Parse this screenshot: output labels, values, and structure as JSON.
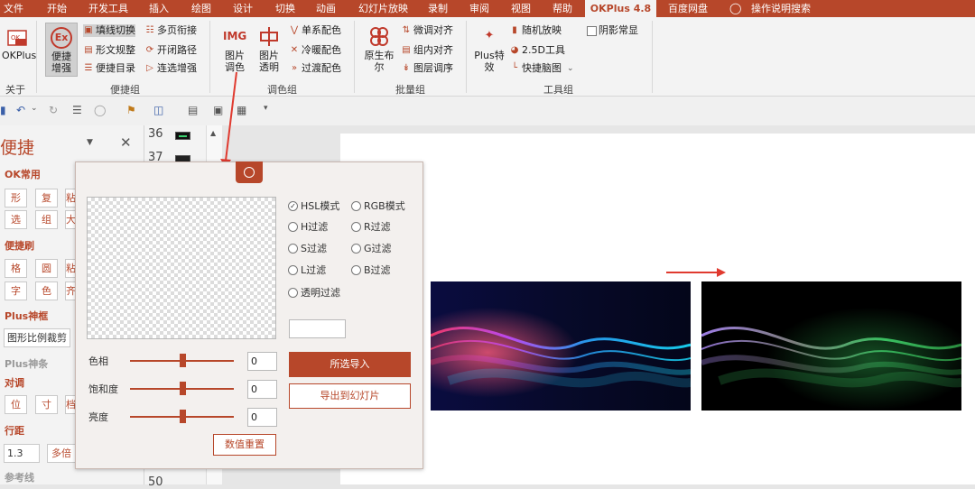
{
  "menu": [
    "文件",
    "开始",
    "开发工具",
    "插入",
    "绘图",
    "设计",
    "切换",
    "动画",
    "幻灯片放映",
    "录制",
    "审阅",
    "视图",
    "帮助",
    "OKPlus 4.8",
    "百度网盘",
    "操作说明搜索"
  ],
  "ribbon": {
    "about": {
      "title": "OKPlus",
      "group": "关于"
    },
    "shortcut_group": {
      "big": "便捷\n增强",
      "items": [
        "填线切换",
        "形文规整",
        "便捷目录",
        "多页衔接",
        "开闭路径",
        "连选增强"
      ],
      "group": "便捷组"
    },
    "color_group": {
      "big1_icon": "IMG",
      "big1": "图片\n调色",
      "big2": "图片\n透明",
      "items": [
        "单系配色",
        "冷暖配色",
        "过渡配色"
      ],
      "group": "调色组"
    },
    "batch_group": {
      "big": "原生布\n尔",
      "items": [
        "微调对齐",
        "组内对齐",
        "图层调序"
      ],
      "group": "批量组"
    },
    "tool_group": {
      "big": "Plus特\n效",
      "items": [
        "随机放映",
        "2.5D工具",
        "快捷脑图",
        "阴影常显"
      ],
      "group": "工具组"
    }
  },
  "pane": {
    "title": "便捷",
    "s1": "OK常用",
    "row1": [
      "形",
      "复",
      "粘"
    ],
    "row2": [
      "选",
      "组",
      "大"
    ],
    "s2": "便捷刷",
    "row3": [
      "格",
      "圆",
      "粘"
    ],
    "row4": [
      "字",
      "色",
      "齐"
    ],
    "s3": "Plus神框",
    "crop_field": "图形比例裁剪",
    "s4": "Plus神条",
    "s5": "对调",
    "row5": [
      "位",
      "寸",
      "档"
    ],
    "s6": "行距",
    "spacing_value": "1.3",
    "multiple_button": "多倍",
    "s7": "参考线"
  },
  "thumbnails": {
    "n1": "36",
    "n2": "37",
    "n3": "50"
  },
  "dialog": {
    "radios": [
      "HSL模式",
      "RGB模式",
      "H过滤",
      "R过滤",
      "S过滤",
      "G过滤",
      "L过滤",
      "B过滤",
      "透明过滤"
    ],
    "selected_radio": "HSL模式",
    "sliders": [
      {
        "label": "色相",
        "value": "0",
        "level": 0.5
      },
      {
        "label": "饱和度",
        "value": "0",
        "level": 0.5
      },
      {
        "label": "亮度",
        "value": "0",
        "level": 0.5
      }
    ],
    "import_button": "所选导入",
    "export_button": "导出到幻灯片",
    "reset_button": "数值重置",
    "color_field": ""
  },
  "colors": {
    "accent": "#b7472a",
    "arrow": "#e03a2f"
  }
}
